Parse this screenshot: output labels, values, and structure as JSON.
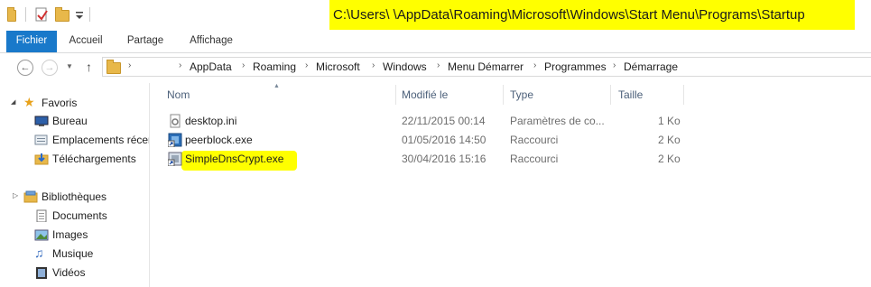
{
  "window": {
    "title_path": "C:\\Users\\          \\AppData\\Roaming\\Microsoft\\Windows\\Start Menu\\Programs\\Startup",
    "highlight_color": "#ffff00"
  },
  "ribbon": {
    "tabs": [
      "Fichier",
      "Accueil",
      "Partage",
      "Affichage"
    ],
    "accent": "#1979ca"
  },
  "address": {
    "crumbs": [
      "AppData",
      "Roaming",
      "Microsoft",
      "Windows",
      "Menu Démarrer",
      "Programmes",
      "Démarrage"
    ]
  },
  "sidebar": {
    "favorites_label": "Favoris",
    "favorites": [
      "Bureau",
      "Emplacements récen",
      "Téléchargements"
    ],
    "libraries_label": "Bibliothèques",
    "libraries": [
      "Documents",
      "Images",
      "Musique",
      "Vidéos"
    ]
  },
  "filelist": {
    "columns": [
      "Nom",
      "Modifié le",
      "Type",
      "Taille"
    ],
    "rows": [
      {
        "name": "desktop.ini",
        "modified": "22/11/2015 00:14",
        "type": "Paramètres de co...",
        "size": "1 Ko",
        "icon": "settings-file-icon"
      },
      {
        "name": "peerblock.exe",
        "modified": "01/05/2016 14:50",
        "type": "Raccourci",
        "size": "2 Ko",
        "icon": "shortcut-icon"
      },
      {
        "name": "SimpleDnsCrypt.exe",
        "modified": "30/04/2016 15:16",
        "type": "Raccourci",
        "size": "2 Ko",
        "icon": "shortcut-icon"
      }
    ]
  }
}
